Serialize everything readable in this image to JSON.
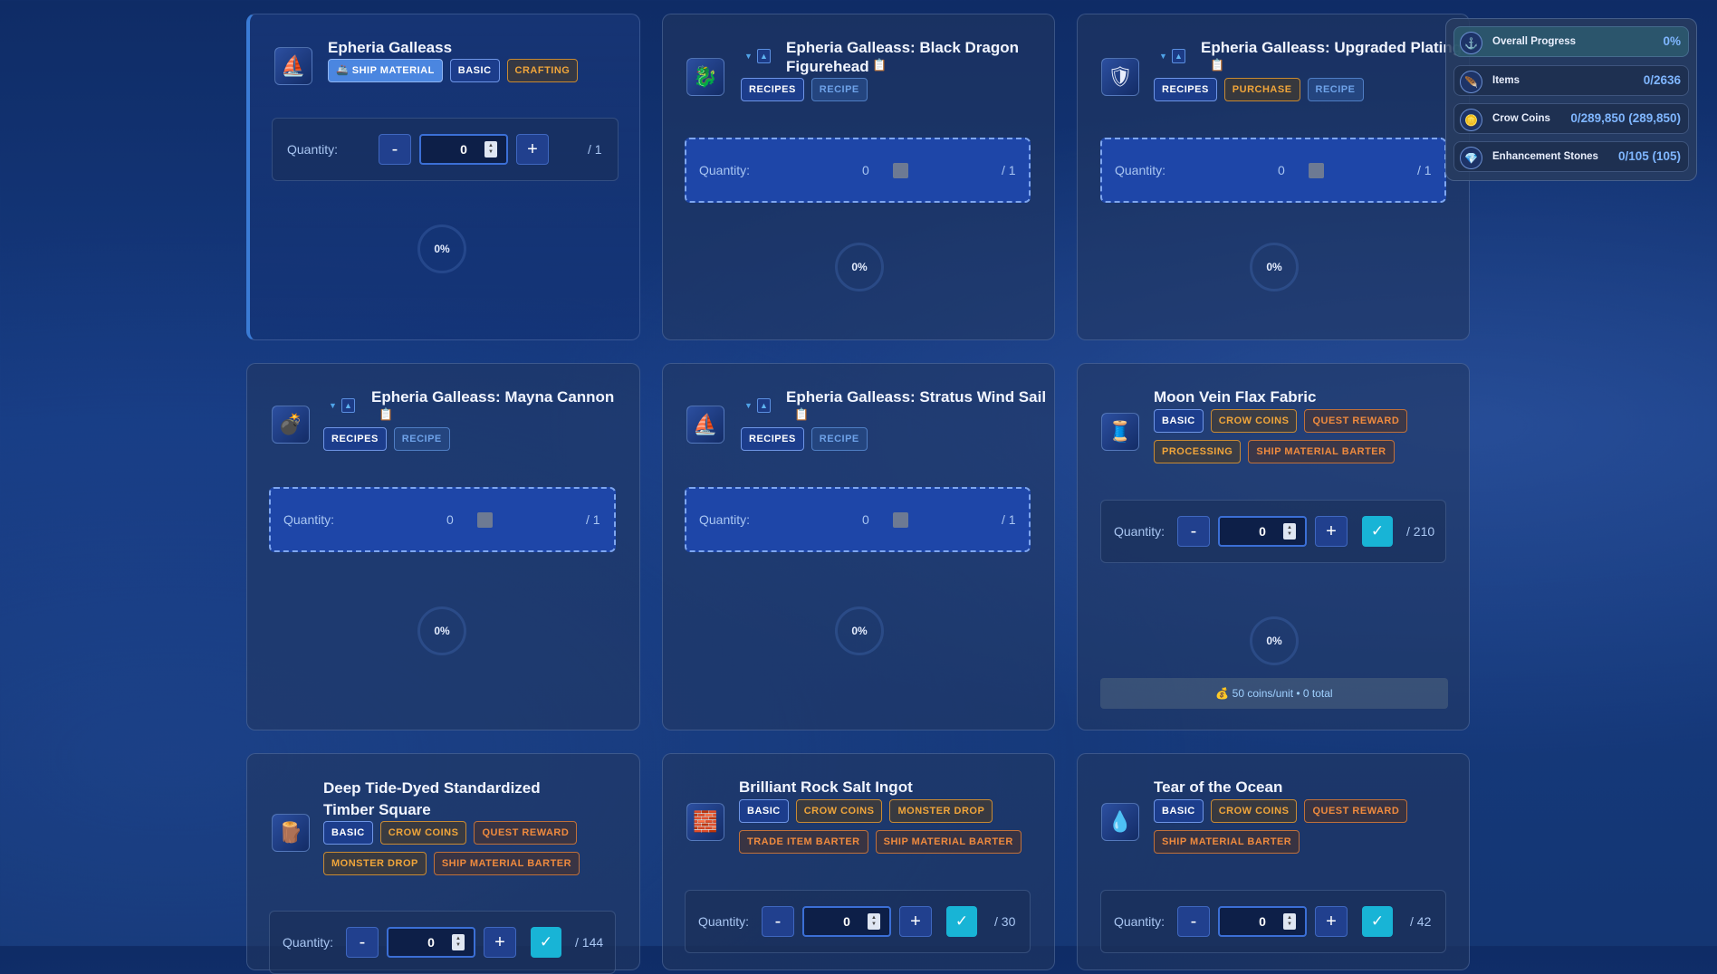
{
  "progress_panel": {
    "overall": {
      "label": "Overall Progress",
      "value": "0%"
    },
    "items": {
      "label": "Items",
      "value": "0/2636"
    },
    "crow_coins": {
      "label": "Crow Coins",
      "value": "0/289,850 (289,850)"
    },
    "enhancement_stones": {
      "label": "Enhancement Stones",
      "value": "0/105 (105)"
    }
  },
  "labels": {
    "quantity": "Quantity:",
    "minus": "-",
    "plus": "+",
    "check": "✓",
    "clipboard": "📋"
  },
  "cards": [
    {
      "title": "Epheria Galleass",
      "tags": [
        "🚢 SHIP MATERIAL",
        "BASIC",
        "CRAFTING"
      ],
      "qty": "0",
      "max": "/ 1",
      "pct": "0%"
    },
    {
      "title": "Epheria Galleass: Black Dragon Figurehead",
      "tags": [
        "RECIPES",
        "RECIPE"
      ],
      "qty": "0",
      "max": "/ 1",
      "pct": "0%"
    },
    {
      "title": "Epheria Galleass: Upgraded Plating",
      "tags": [
        "RECIPES",
        "PURCHASE",
        "RECIPE"
      ],
      "qty": "0",
      "max": "/ 1",
      "pct": "0%"
    },
    {
      "title": "Epheria Galleass: Mayna Cannon",
      "tags": [
        "RECIPES",
        "RECIPE"
      ],
      "qty": "0",
      "max": "/ 1",
      "pct": "0%"
    },
    {
      "title": "Epheria Galleass: Stratus Wind Sail",
      "tags": [
        "RECIPES",
        "RECIPE"
      ],
      "qty": "0",
      "max": "/ 1",
      "pct": "0%"
    },
    {
      "title": "Moon Vein Flax Fabric",
      "tags": [
        "BASIC",
        "CROW COINS",
        "QUEST REWARD",
        "PROCESSING",
        "SHIP MATERIAL BARTER"
      ],
      "qty": "0",
      "max": "/ 210",
      "pct": "0%",
      "coins": "💰 50 coins/unit • 0 total"
    },
    {
      "title": "Deep Tide-Dyed Standardized Timber Square",
      "tags": [
        "BASIC",
        "CROW COINS",
        "QUEST REWARD",
        "MONSTER DROP",
        "SHIP MATERIAL BARTER"
      ],
      "qty": "0",
      "max": "/ 144"
    },
    {
      "title": "Brilliant Rock Salt Ingot",
      "tags": [
        "BASIC",
        "CROW COINS",
        "MONSTER DROP",
        "TRADE ITEM BARTER",
        "SHIP MATERIAL BARTER"
      ],
      "qty": "0",
      "max": "/ 30"
    },
    {
      "title": "Tear of the Ocean",
      "tags": [
        "BASIC",
        "CROW COINS",
        "QUEST REWARD",
        "SHIP MATERIAL BARTER"
      ],
      "qty": "0",
      "max": "/ 42"
    }
  ],
  "icons": [
    "ship-icon",
    "dragon-figurehead-icon",
    "plating-icon",
    "cannon-icon",
    "wind-sail-icon",
    "flax-fabric-icon",
    "timber-icon",
    "salt-ingot-icon",
    "ocean-tear-icon"
  ]
}
